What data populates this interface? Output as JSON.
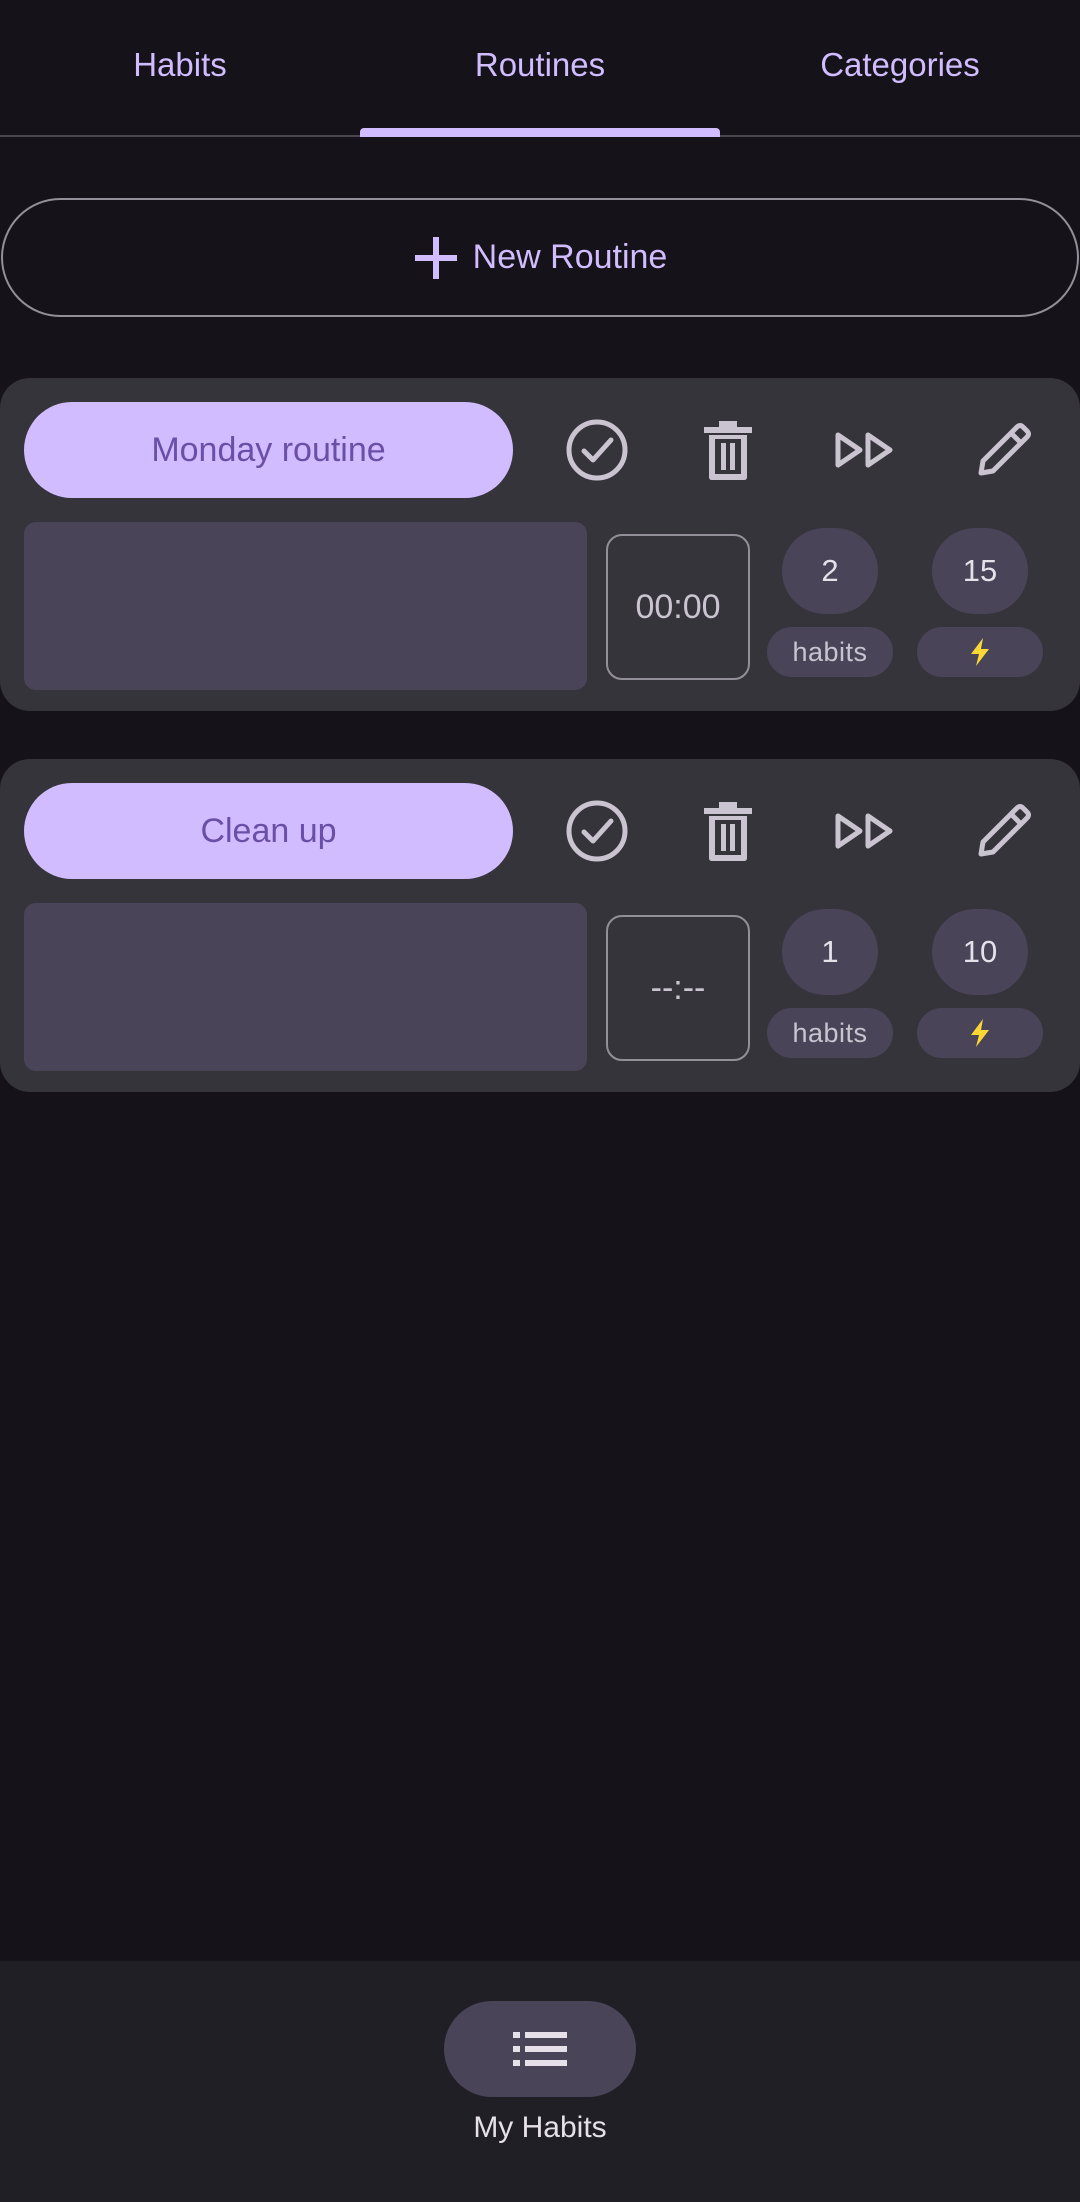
{
  "tabs": {
    "items": [
      {
        "label": "Habits"
      },
      {
        "label": "Routines"
      },
      {
        "label": "Categories"
      }
    ],
    "selected": "Routines"
  },
  "new_routine": {
    "label": "New Routine",
    "icon": "plus-icon"
  },
  "routines": [
    {
      "name": "Monday routine",
      "time": "00:00",
      "habits_count": "2",
      "habits_label": "habits",
      "energy": "15",
      "energy_icon": "lightning-icon"
    },
    {
      "name": "Clean up",
      "time": "--:--",
      "habits_count": "1",
      "habits_label": "habits",
      "energy": "10",
      "energy_icon": "lightning-icon"
    }
  ],
  "card_actions": [
    "check-circle-icon",
    "trash-icon",
    "fast-forward-icon",
    "pencil-icon"
  ],
  "bottom_nav": {
    "label": "My Habits",
    "icon": "list-icon"
  },
  "colors": {
    "background": "#151219",
    "card": "#36343b",
    "accent": "#d0bcff",
    "surface_variant": "#4a4458",
    "outline": "#938f99",
    "energy": "#fdd835"
  }
}
